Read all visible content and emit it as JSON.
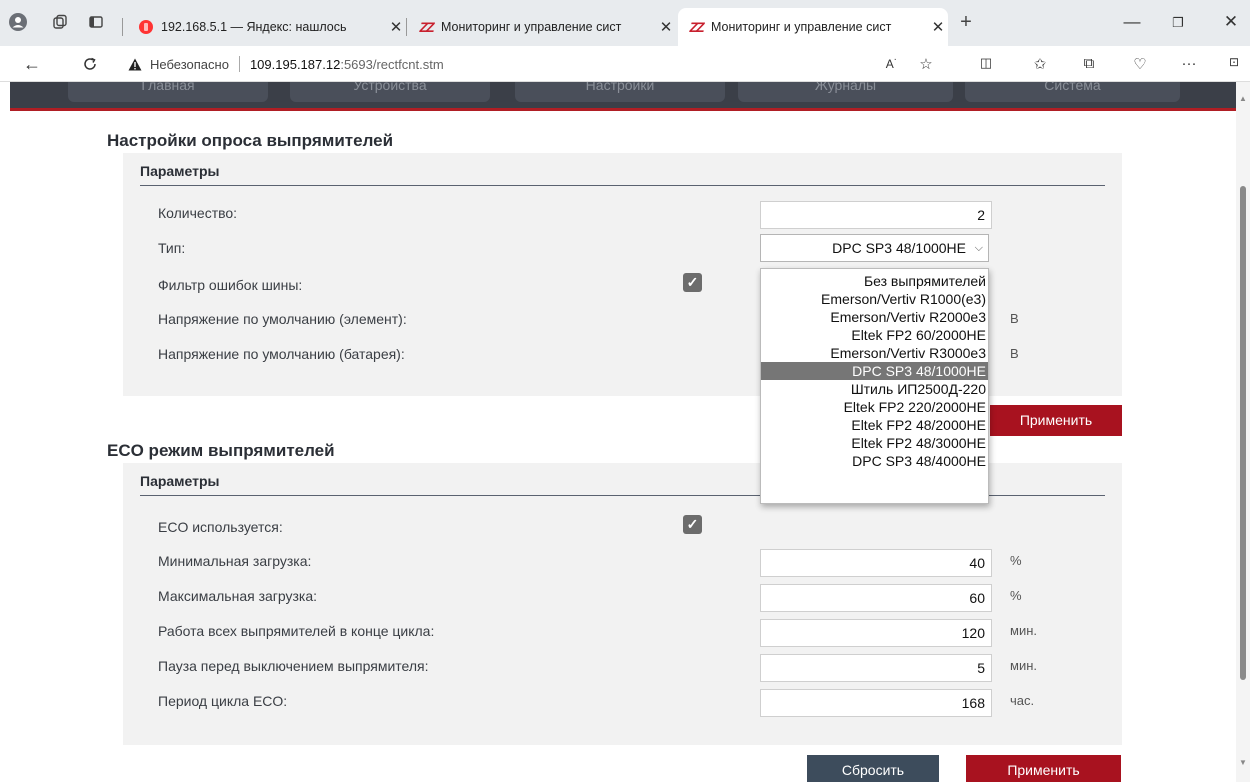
{
  "browser": {
    "tabs": [
      {
        "title": "192.168.5.1 — Яндекс: нашлось",
        "favicon": "yandex-icon"
      },
      {
        "title": "Мониторинг и управление сист",
        "favicon": "app-logo-icon"
      },
      {
        "title": "Мониторинг и управление сист",
        "favicon": "app-logo-icon",
        "active": true
      }
    ],
    "new_tab": "+",
    "security_label": "Небезопасно",
    "url_host": "109.195.187.12",
    "url_rest": ":5693/rectfcnt.stm"
  },
  "nav": {
    "items": [
      "Главная",
      "Устройства",
      "Настройки",
      "Журналы",
      "Система"
    ]
  },
  "poll": {
    "title": "Настройки опроса выпрямителей",
    "panel_title": "Параметры",
    "quantity_label": "Количество:",
    "quantity_value": "2",
    "type_label": "Тип:",
    "type_value": "DPC SP3 48/1000HE",
    "bus_filter_label": "Фильтр ошибок шины:",
    "bus_filter_checked": true,
    "voltage_cell_label": "Напряжение по умолчанию (элемент):",
    "voltage_cell_unit": "В",
    "voltage_battery_label": "Напряжение по умолчанию (батарея):",
    "voltage_battery_unit": "В",
    "apply_label": "Применить"
  },
  "type_options": [
    "Без выпрямителей",
    "Emerson/Vertiv R1000(e3)",
    "Emerson/Vertiv R2000e3",
    "Eltek FP2 60/2000HE",
    "Emerson/Vertiv R3000e3",
    "DPC SP3 48/1000HE",
    "Штиль ИП2500Д-220",
    "Eltek FP2 220/2000HE",
    "Eltek FP2 48/2000HE",
    "Eltek FP2 48/3000HE",
    "DPC SP3 48/4000HE"
  ],
  "type_selected_index": 5,
  "eco": {
    "title": "ECO режим выпрямителей",
    "panel_title": "Параметры",
    "used_label": "ECO используется:",
    "used_checked": true,
    "min_load_label": "Минимальная загрузка:",
    "min_load_value": "40",
    "min_load_unit": "%",
    "max_load_label": "Максимальная загрузка:",
    "max_load_value": "60",
    "max_load_unit": "%",
    "all_run_label": "Работа всех выпрямителей в конце цикла:",
    "all_run_value": "120",
    "all_run_unit": "мин.",
    "pause_label": "Пауза перед выключением выпрямителя:",
    "pause_value": "5",
    "pause_unit": "мин.",
    "period_label": "Период цикла ECO:",
    "period_value": "168",
    "period_unit": "час."
  },
  "footer": {
    "reset_label": "Сбросить",
    "apply_label": "Применить"
  },
  "colors": {
    "accent_red": "#a8121f",
    "nav_dark": "#3b3f48",
    "button_dark": "#3d4c5c"
  }
}
